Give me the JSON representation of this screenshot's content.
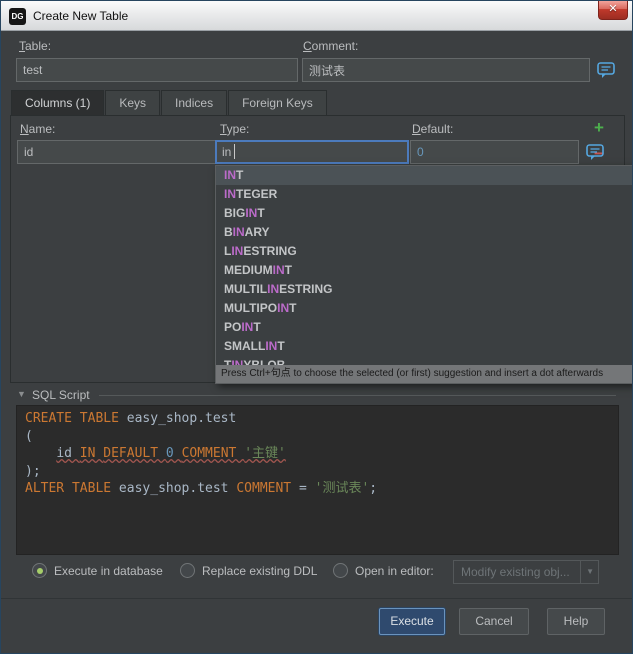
{
  "window": {
    "title": "Create New Table",
    "app_icon": "DG"
  },
  "icons": {
    "close": "✕",
    "add": "+",
    "remove": "−",
    "collapse": "▼",
    "combo_arrow": "▼"
  },
  "form": {
    "table_label": "Table:",
    "table_value": "test",
    "comment_label": "Comment:",
    "comment_value": "测试表"
  },
  "tabs": [
    {
      "label": "Columns (1)",
      "selected": true
    },
    {
      "label": "Keys",
      "selected": false
    },
    {
      "label": "Indices",
      "selected": false
    },
    {
      "label": "Foreign Keys",
      "selected": false
    }
  ],
  "columns_form": {
    "name_label": "Name:",
    "name_value": "id",
    "type_label": "Type:",
    "type_value": "in",
    "default_label": "Default:",
    "default_value": "0"
  },
  "suggestions": {
    "match": "in",
    "selected_index": 0,
    "items": [
      "INT",
      "INTEGER",
      "BIGINT",
      "BINARY",
      "LINESTRING",
      "MEDIUMINT",
      "MULTILINESTRING",
      "MULTIPOINT",
      "POINT",
      "SMALLINT",
      "TINYBLOB"
    ],
    "hint": "Press Ctrl+句点 to choose the selected (or first) suggestion and insert a dot afterwards"
  },
  "sql_section": {
    "title": "SQL Script",
    "lines": [
      [
        {
          "t": "CREATE",
          "c": "kw"
        },
        {
          "t": " ",
          "c": "pl"
        },
        {
          "t": "TABLE",
          "c": "kw"
        },
        {
          "t": " easy_shop.test",
          "c": "pl"
        }
      ],
      [
        {
          "t": "(",
          "c": "pl"
        }
      ],
      [
        {
          "t": "    ",
          "c": "pl"
        },
        {
          "t": "id ",
          "c": "pl err"
        },
        {
          "t": "IN ",
          "c": "kw err"
        },
        {
          "t": "DEFAULT ",
          "c": "kw err"
        },
        {
          "t": "0 ",
          "c": "num err"
        },
        {
          "t": "COMMENT ",
          "c": "kw err"
        },
        {
          "t": "'主键'",
          "c": "str err"
        }
      ],
      [
        {
          "t": ");",
          "c": "pl"
        }
      ],
      [
        {
          "t": "ALTER",
          "c": "kw"
        },
        {
          "t": " ",
          "c": "pl"
        },
        {
          "t": "TABLE",
          "c": "kw"
        },
        {
          "t": " easy_shop.test ",
          "c": "pl"
        },
        {
          "t": "COMMENT",
          "c": "kw"
        },
        {
          "t": " = ",
          "c": "pl"
        },
        {
          "t": "'测试表'",
          "c": "str"
        },
        {
          "t": ";",
          "c": "pl"
        }
      ]
    ]
  },
  "options": {
    "radios": [
      {
        "label": "Execute in database",
        "selected": true
      },
      {
        "label": "Replace existing DDL",
        "selected": false
      },
      {
        "label": "Open in editor:",
        "selected": false
      }
    ],
    "editor_combo": "Modify existing obj..."
  },
  "buttons": {
    "execute": "Execute",
    "cancel": "Cancel",
    "help": "Help"
  }
}
